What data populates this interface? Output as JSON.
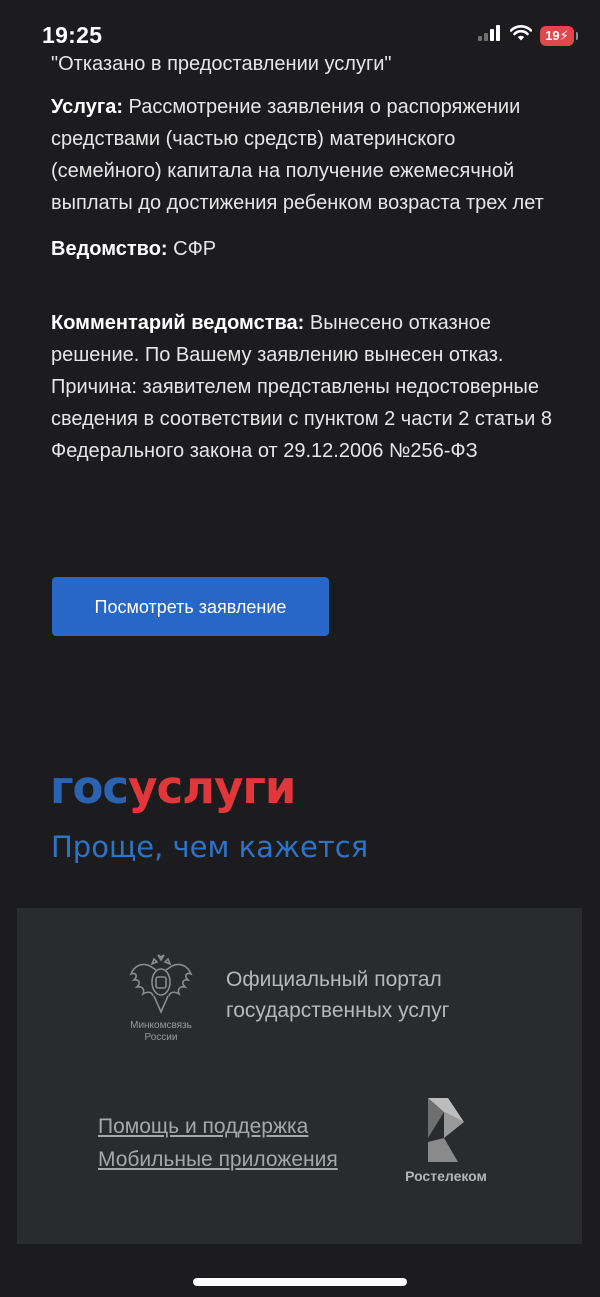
{
  "status_bar": {
    "time": "19:25",
    "battery_level": "19"
  },
  "notice": {
    "status_text": "\"Отказано в предоставлении услуги\"",
    "service_label": "Услуга:",
    "service_value": "Рассмотрение заявления о распоряжении средствами (частью средств) материнского (семейного) капитала на получение ежемесячной выплаты до достижения ребенком возраста трех лет",
    "department_label": "Ведомство:",
    "department_value": "СФР",
    "comment_label": "Комментарий ведомства:",
    "comment_value": "Вынесено отказное решение. По Вашему заявлению вынесен отказ. Причина: заявителем представлены недостоверные сведения в соответствии с пунктом 2 части 2 статьи 8 Федерального закона от 29.12.2006 №256-ФЗ",
    "view_button_label": "Посмотреть заявление"
  },
  "brand": {
    "logo_part_a": "гос",
    "logo_part_b": "услуги",
    "tagline": "Проще, чем кажется"
  },
  "footer": {
    "ministry_caption": "Минкомсвязь России",
    "portal_name": "Официальный портал государственных услуг",
    "links": [
      "Помощь и поддержка",
      "Мобильные приложения"
    ],
    "operator_name": "Ростелеком"
  },
  "colors": {
    "background": "#1c1c1e",
    "button": "#2867c6",
    "logo_blue": "#2a63b2",
    "logo_red": "#e3363b",
    "footer_bg": "#2a2b2d"
  },
  "icons": {
    "signal": "cellular-signal-icon",
    "wifi": "wifi-icon",
    "battery": "battery-charging-icon",
    "emblem": "russian-coat-of-arms-icon",
    "operator_logo": "rostelecom-logo-icon"
  }
}
